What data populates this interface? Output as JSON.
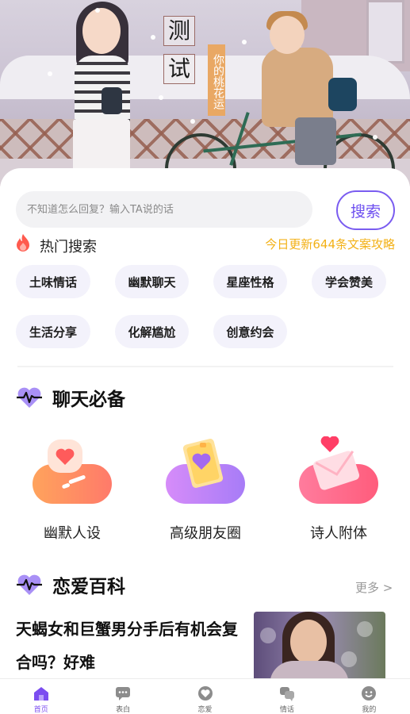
{
  "hero": {
    "title_char_1": "测",
    "title_char_2": "试",
    "tagline": "你的桃花运"
  },
  "search": {
    "placeholder": "不知道怎么回复？输入TA说的话",
    "button_label": "搜索"
  },
  "hot": {
    "title": "热门搜索",
    "update_text": "今日更新644条文案攻略",
    "chips": [
      "土味情话",
      "幽默聊天",
      "星座性格",
      "学会赞美",
      "生活分享",
      "化解尴尬",
      "创意约会"
    ]
  },
  "chat_section": {
    "title": "聊天必备",
    "features": [
      {
        "label": "幽默人设",
        "icon": "chat-bubble-heart-icon",
        "color": "#ff8a5c"
      },
      {
        "label": "高级朋友圈",
        "icon": "heart-card-icon",
        "color": "#b87cf7"
      },
      {
        "label": "诗人附体",
        "icon": "love-letter-icon",
        "color": "#ff6b8f"
      }
    ]
  },
  "wiki_section": {
    "title": "恋爱百科",
    "more_label": "更多 >",
    "article_title": "天蝎女和巨蟹男分手后有机会复合吗？好难"
  },
  "tabbar": {
    "items": [
      {
        "label": "首页",
        "icon": "home-icon",
        "active": true
      },
      {
        "label": "表白",
        "icon": "chat-icon",
        "active": false
      },
      {
        "label": "恋爱",
        "icon": "heart-circle-icon",
        "active": false
      },
      {
        "label": "情话",
        "icon": "dialog-icon",
        "active": false
      },
      {
        "label": "我的",
        "icon": "profile-icon",
        "active": false
      }
    ]
  },
  "colors": {
    "accent": "#7b4df0",
    "update_text": "#f3b117",
    "chip_bg": "#f3f2fb"
  }
}
